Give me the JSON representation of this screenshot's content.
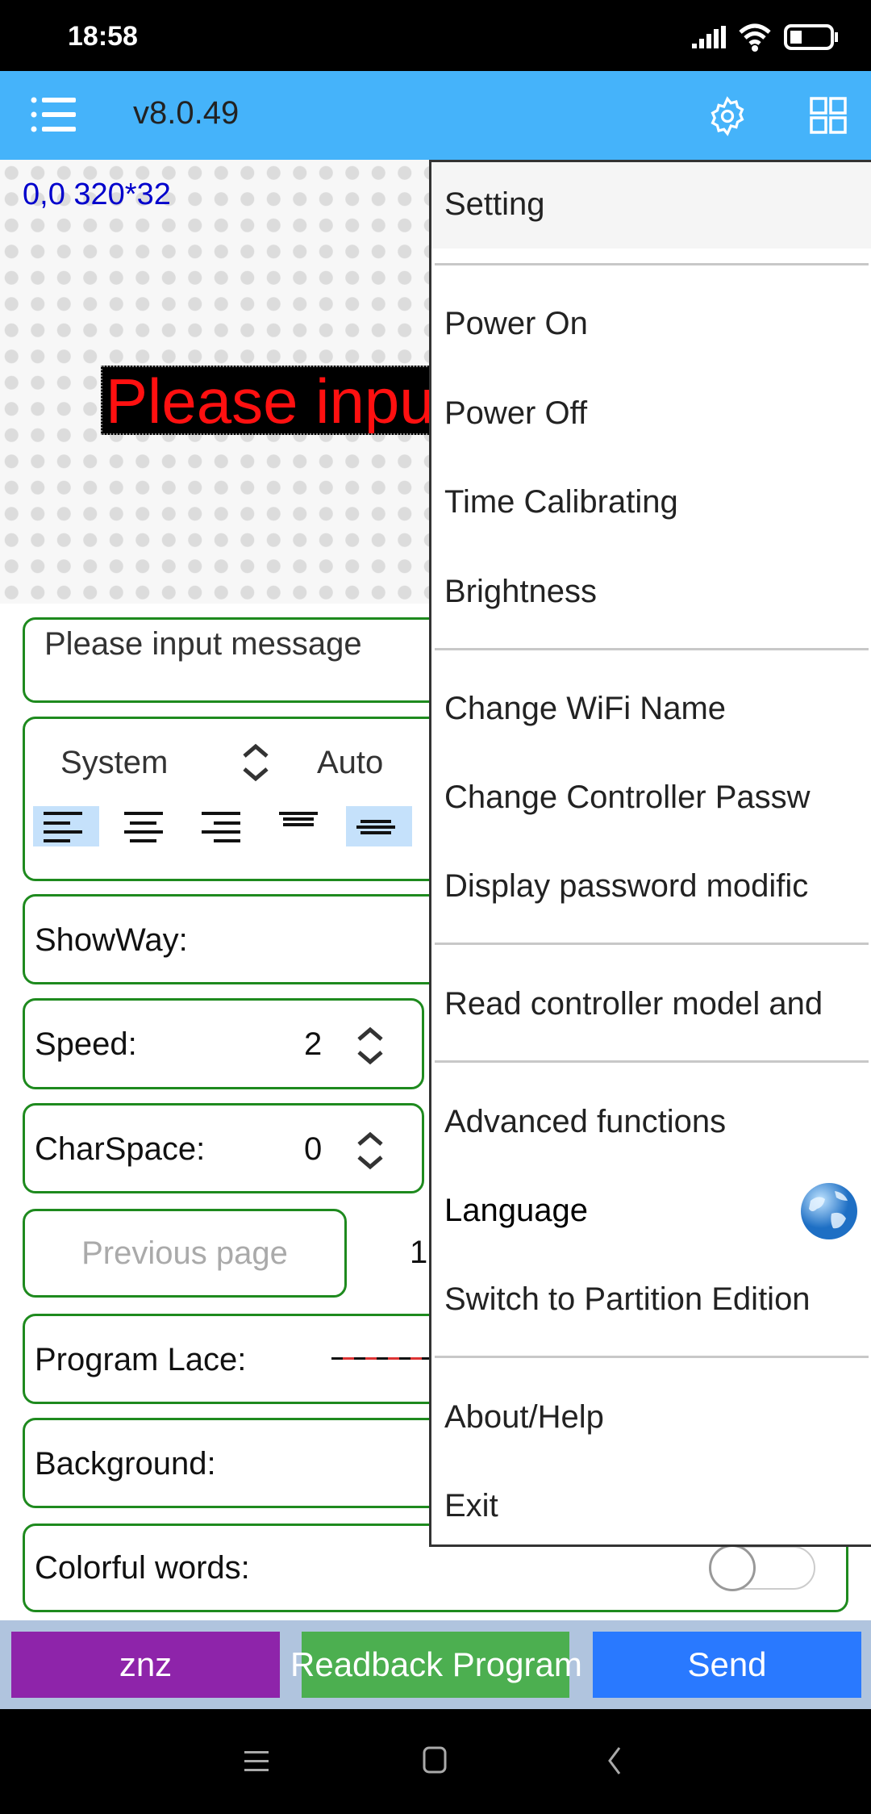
{
  "status_bar": {
    "time": "18:58",
    "icons": [
      "signal-icon",
      "wifi-icon",
      "battery-icon"
    ]
  },
  "header": {
    "title": "v8.0.49",
    "icons": [
      "menu-list-icon",
      "gear-icon",
      "grid-icon"
    ]
  },
  "preview": {
    "coords": "0,0 320*32",
    "led_text": "Please input message",
    "led_color": "#ff1010"
  },
  "form": {
    "message_input": {
      "value": "Please input message"
    },
    "font": {
      "value": "System",
      "size": "Auto",
      "alignments": [
        "align-left",
        "align-center",
        "align-right",
        "valign-top",
        "valign-middle"
      ],
      "selected": [
        "align-left",
        "valign-middle"
      ]
    },
    "showway": {
      "label": "ShowWay:"
    },
    "speed": {
      "label": "Speed:",
      "value": "2"
    },
    "charspace": {
      "label": "CharSpace:",
      "value": "0"
    },
    "prev_page": {
      "label": "Previous page"
    },
    "page_number": "1",
    "program_lace": {
      "label": "Program Lace:"
    },
    "background": {
      "label": "Background:"
    },
    "colorful_words": {
      "label": "Colorful words:",
      "enabled": false
    }
  },
  "bottom_buttons": [
    {
      "label": "znz",
      "color": "#8e24aa"
    },
    {
      "label": "Readback Program",
      "color": "#4caf50"
    },
    {
      "label": "Send",
      "color": "#2979ff"
    }
  ],
  "menu": {
    "items": [
      {
        "label": "Setting"
      },
      {
        "label": "Power On"
      },
      {
        "label": "Power Off"
      },
      {
        "label": "Time Calibrating"
      },
      {
        "label": "Brightness"
      },
      {
        "label": "Change WiFi Name"
      },
      {
        "label": "Change Controller Passw"
      },
      {
        "label": "Display password modific"
      },
      {
        "label": "Read controller model and"
      },
      {
        "label": "Advanced functions"
      },
      {
        "label": "Language",
        "icon": "globe-icon"
      },
      {
        "label": "Switch to Partition Edition"
      },
      {
        "label": "About/Help"
      },
      {
        "label": "Exit"
      }
    ]
  },
  "colors": {
    "header": "#45b3fa",
    "border": "#1e8a1e",
    "coords": "#0000cc"
  }
}
